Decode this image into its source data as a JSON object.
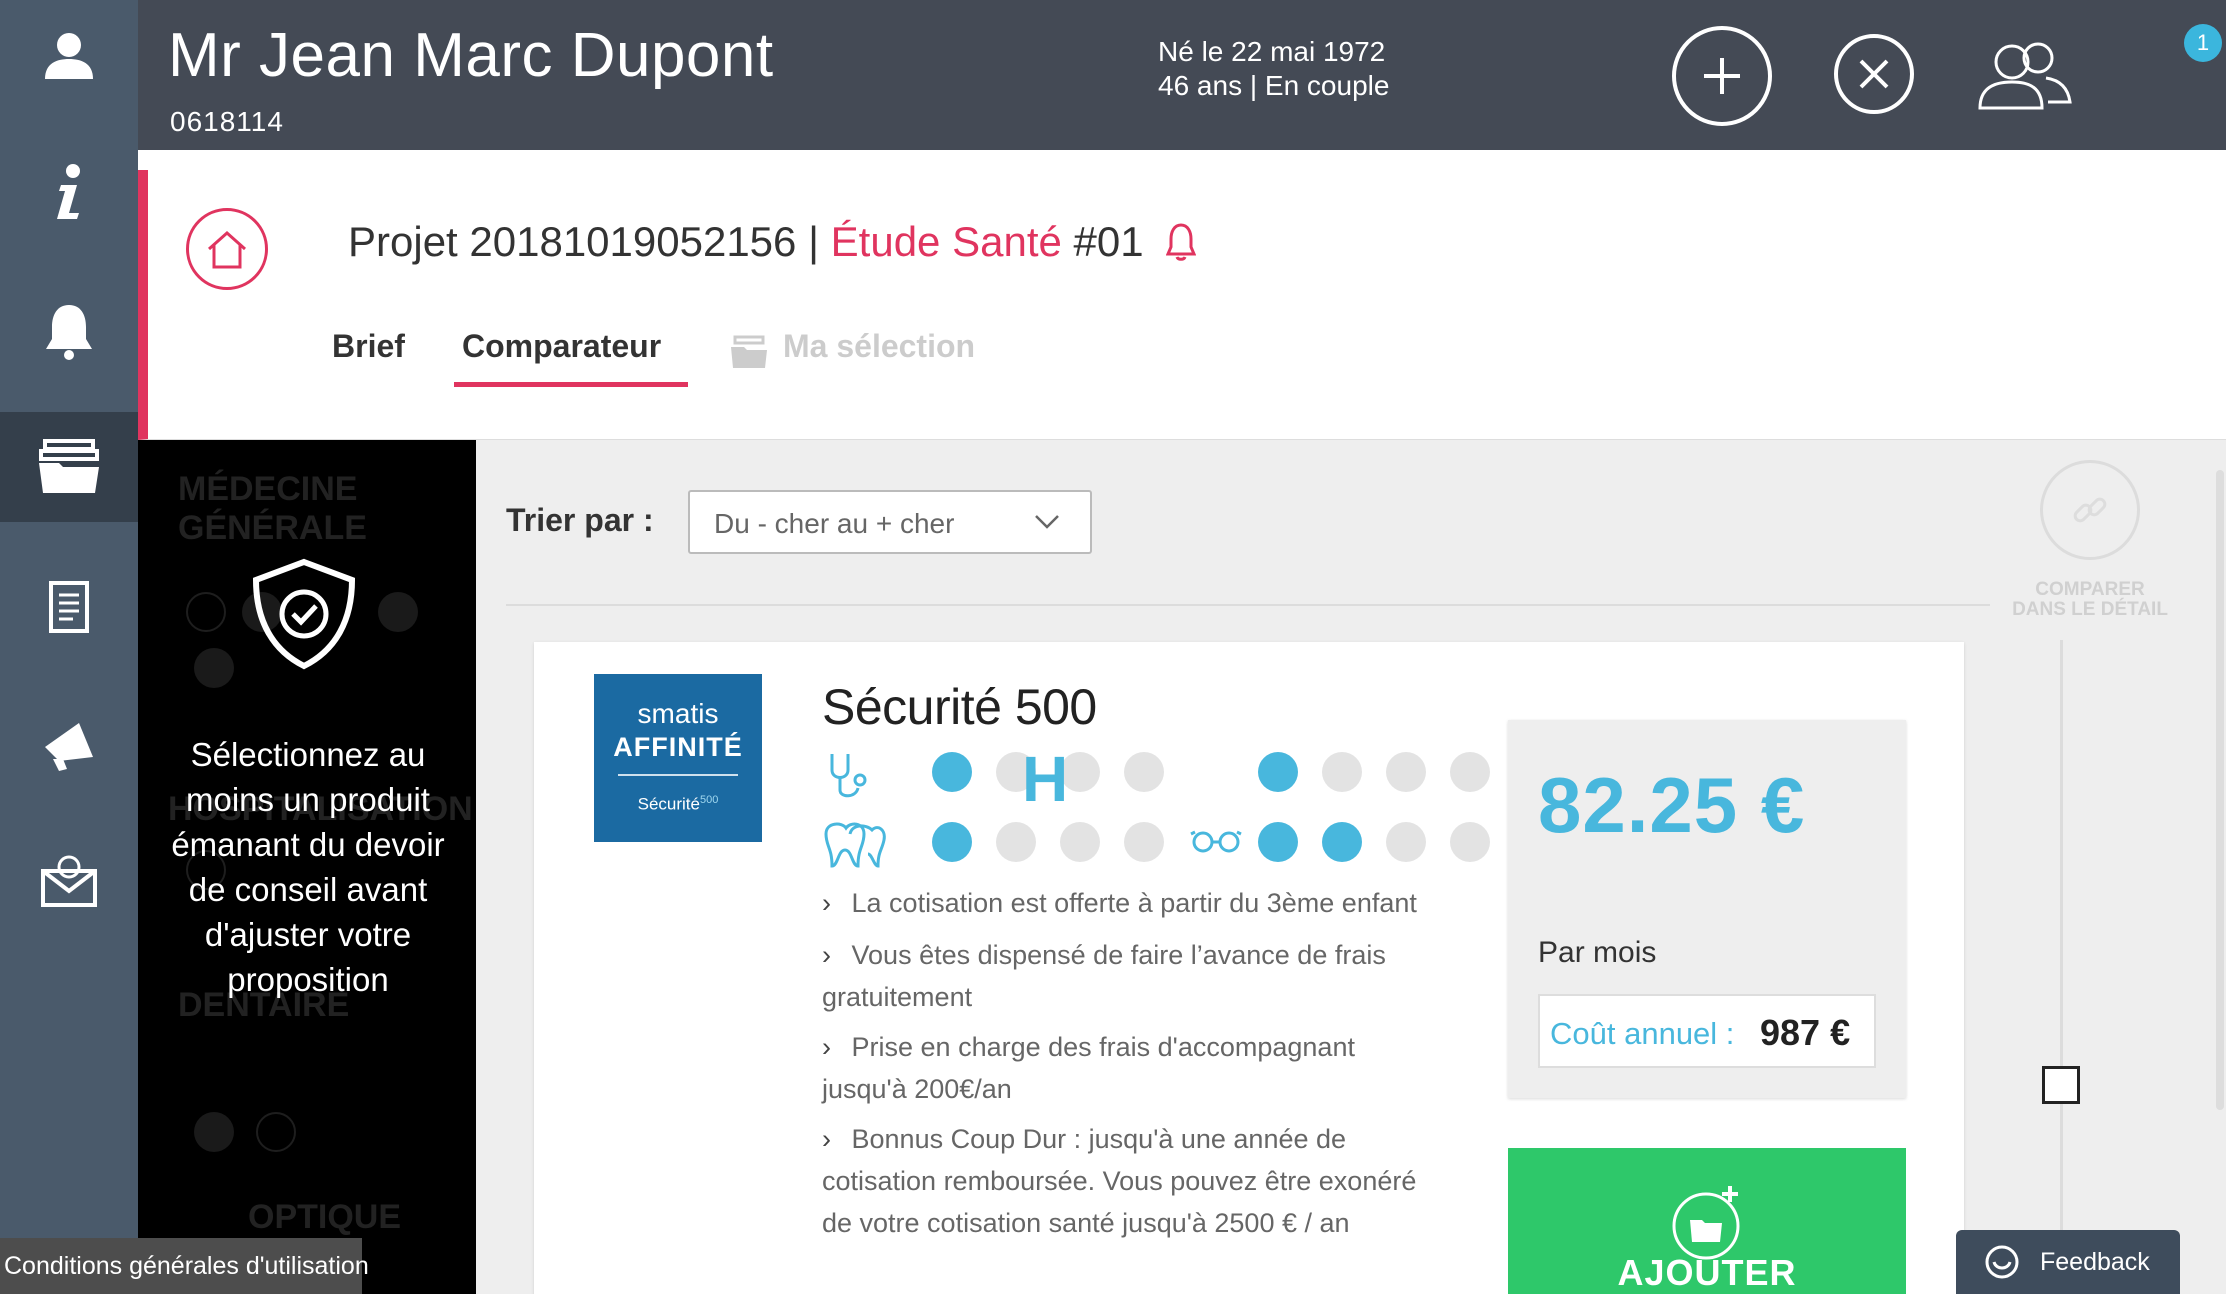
{
  "header": {
    "patient_name": "Mr Jean Marc Dupont",
    "patient_id": "0618114",
    "birth": "Né le 22 mai 1972",
    "age_status": "46 ans | En couple",
    "notifications_count": "1"
  },
  "sidebar": {
    "items": [
      {
        "icon": "user-icon"
      },
      {
        "icon": "info-icon"
      },
      {
        "icon": "bell-icon"
      },
      {
        "icon": "folders-icon",
        "active": true
      },
      {
        "icon": "document-icon"
      },
      {
        "icon": "megaphone-icon"
      },
      {
        "icon": "mail-icon"
      }
    ]
  },
  "project": {
    "title_prefix": "Projet 20181019052156 |",
    "study": "Étude Santé",
    "number": "#01",
    "tabs": {
      "brief": "Brief",
      "comparateur": "Comparateur",
      "selection": "Ma sélection"
    }
  },
  "criteria": {
    "categories": [
      "MÉDECINE GÉNÉRALE",
      "HOSPITALISATION",
      "DENTAIRE",
      "OPTIQUE"
    ],
    "message": "Sélectionnez au moins un produit émanant du devoir de conseil avant d'ajuster votre proposition"
  },
  "sort": {
    "label": "Trier par :",
    "value": "Du - cher au + cher"
  },
  "compare": {
    "label": "COMPARER DANS LE DÉTAIL"
  },
  "product": {
    "logo_brand": "smatis",
    "logo_product": "AFFINITÉ",
    "logo_tag": "Sécurité",
    "logo_tag_sup": "500",
    "name": "Sécurité 500",
    "levels": {
      "medecine": 1,
      "hospitalisation": 1,
      "dentaire": 1,
      "optique": 2
    },
    "features": [
      "La cotisation est offerte à partir du 3ème enfant",
      "Vous êtes dispensé de faire l’avance de frais gratuitement",
      "Prise en charge des frais d'accompagnant jusqu'à 200€/an",
      "Bonnus Coup Dur : jusqu'à une année de cotisation remboursée. Vous pouvez être exonéré de votre cotisation santé jusqu'à 2500 € / an"
    ],
    "price": "82.25 €",
    "price_period": "Par mois",
    "annual_label": "Coût annuel :",
    "annual_value": "987 €",
    "add_label": "AJOUTER"
  },
  "footer": {
    "cgu": "Conditions générales d'utilisation",
    "feedback": "Feedback"
  },
  "colors": {
    "accent": "#e0345f",
    "blue": "#48b7dd",
    "green": "#2ec86a",
    "sidebar": "#4a5a6b",
    "header": "#444a55"
  }
}
